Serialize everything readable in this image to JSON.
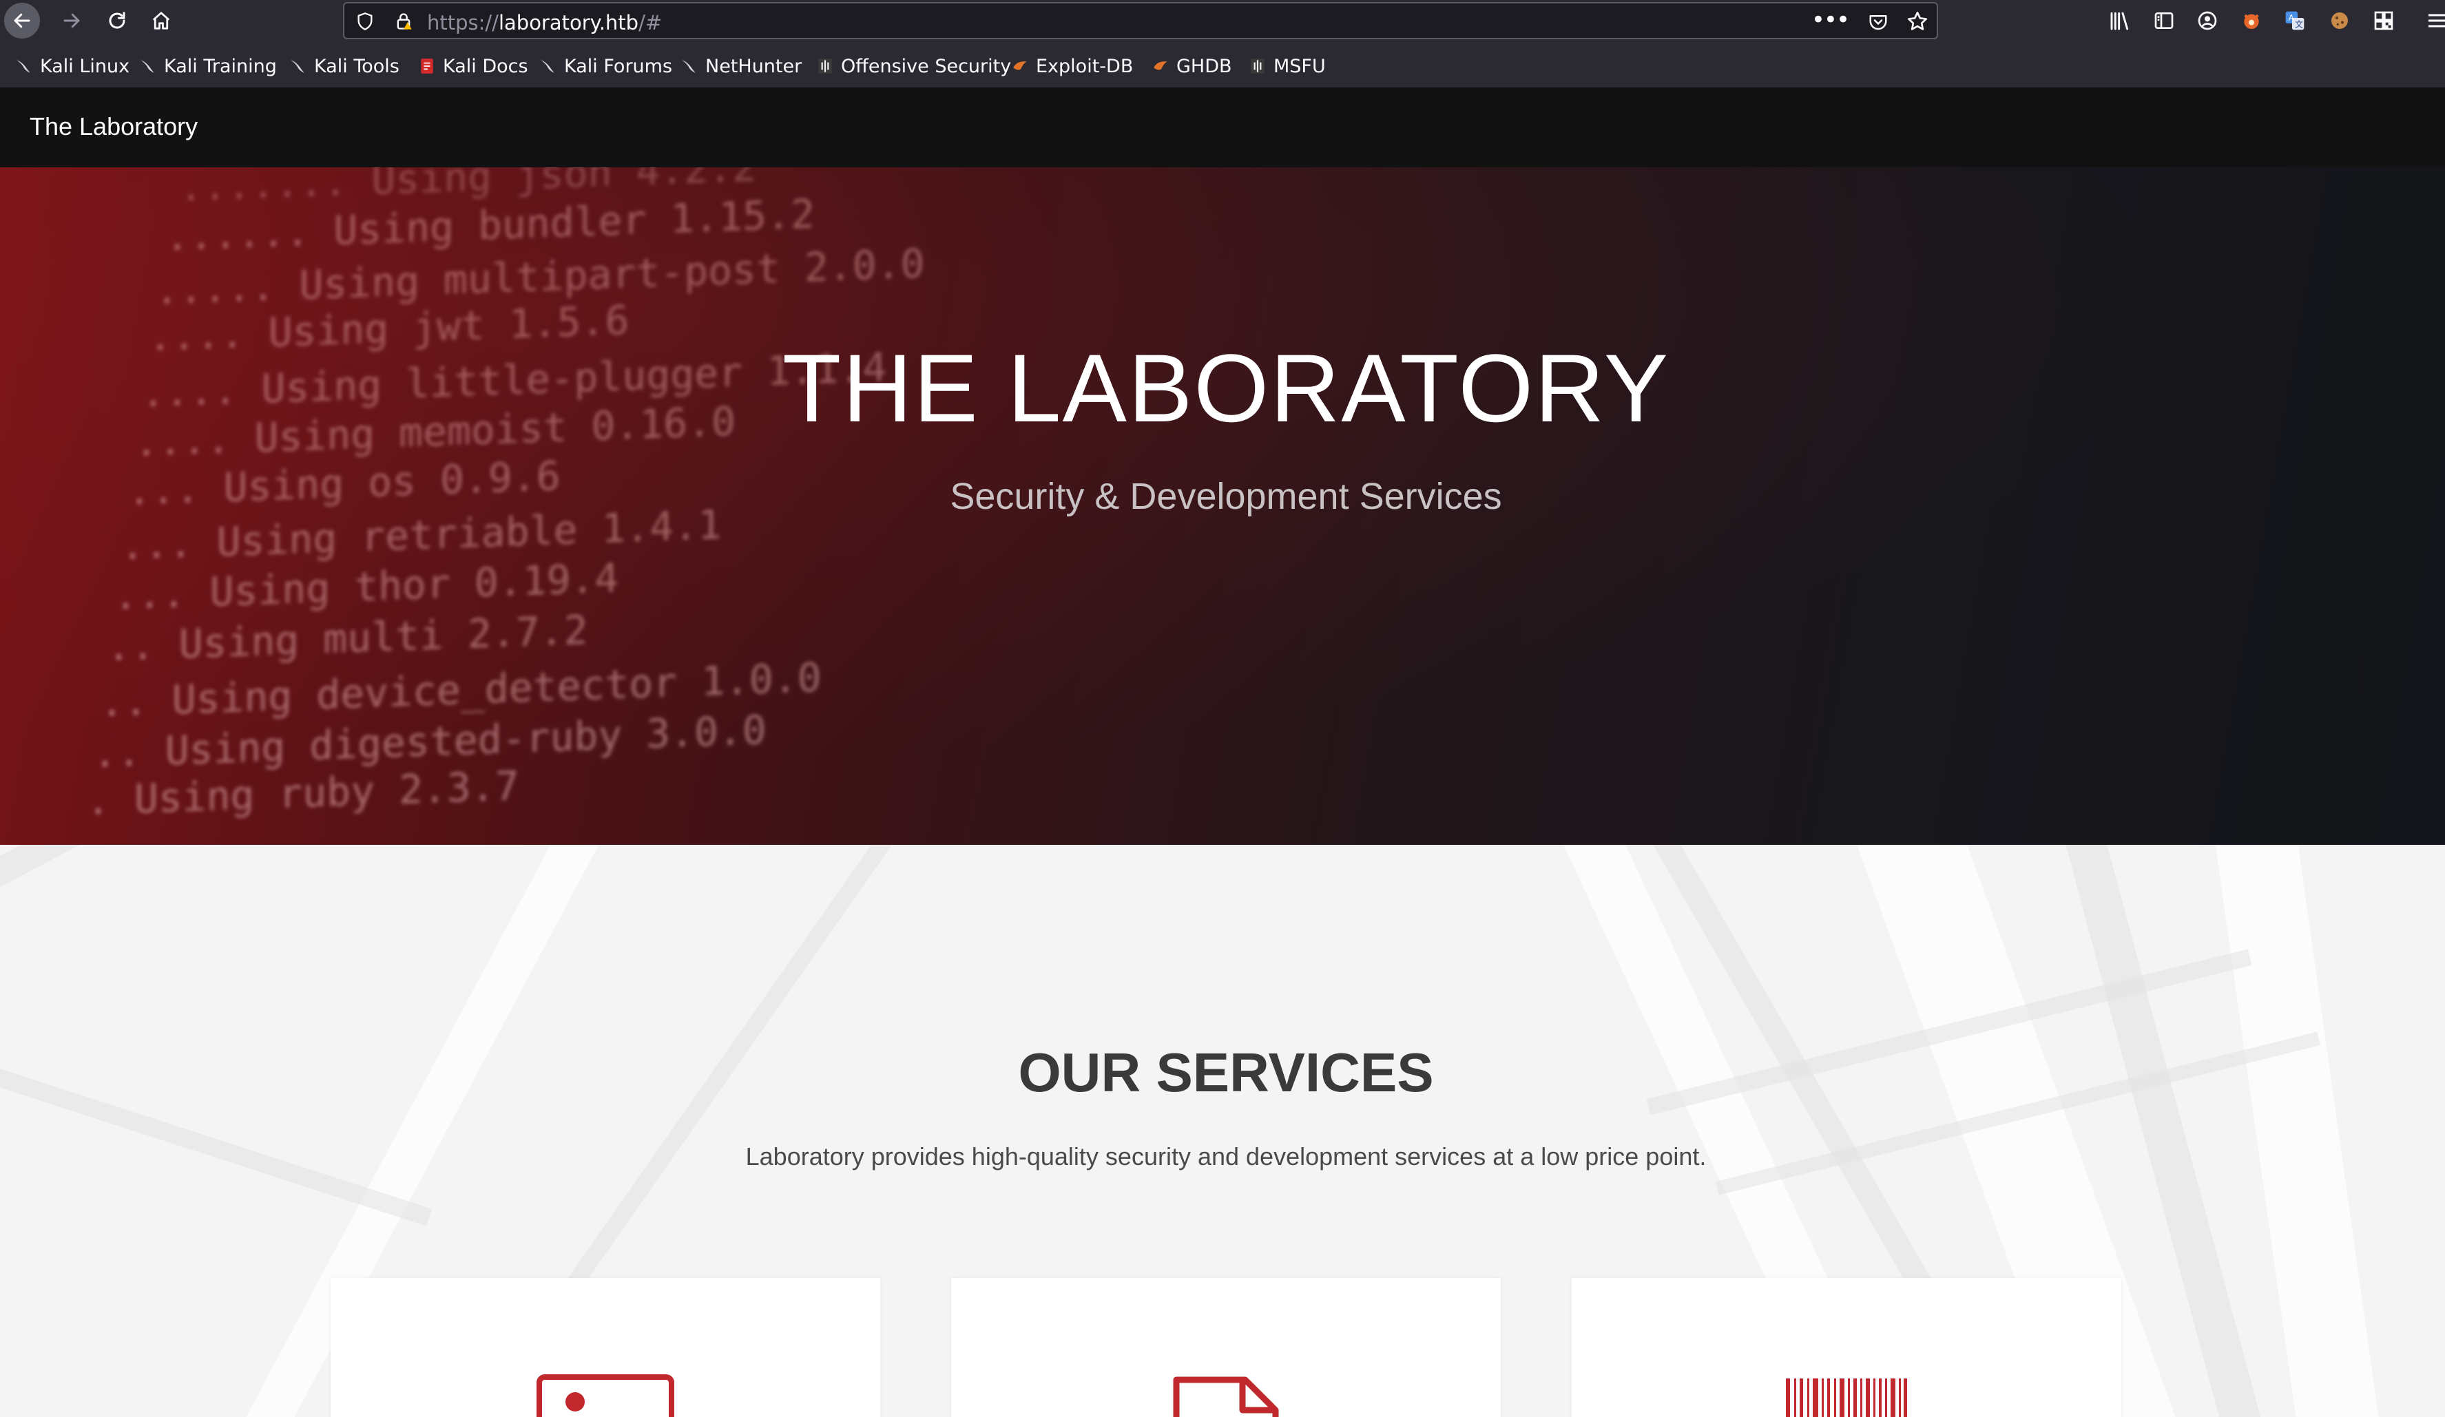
{
  "browser": {
    "url_scheme": "https://",
    "url_host": "laboratory.htb",
    "url_path": "/#",
    "bookmarks": [
      {
        "label": "Kali Linux",
        "icon": "kali-dragon-icon"
      },
      {
        "label": "Kali Training",
        "icon": "kali-dragon-icon"
      },
      {
        "label": "Kali Tools",
        "icon": "kali-dragon-icon"
      },
      {
        "label": "Kali Docs",
        "icon": "kali-docs-icon"
      },
      {
        "label": "Kali Forums",
        "icon": "kali-dragon-icon"
      },
      {
        "label": "NetHunter",
        "icon": "kali-dragon-icon"
      },
      {
        "label": "Offensive Security",
        "icon": "offsec-icon"
      },
      {
        "label": "Exploit-DB",
        "icon": "exploit-db-icon"
      },
      {
        "label": "GHDB",
        "icon": "exploit-db-icon"
      },
      {
        "label": "MSFU",
        "icon": "offsec-icon"
      }
    ]
  },
  "site": {
    "brand": "The Laboratory",
    "hero": {
      "title": "THE LABORATORY",
      "subtitle": "Security & Development Services"
    },
    "services": {
      "title": "OUR SERVICES",
      "description": "Laboratory provides high-quality security and development services at a low price point.",
      "cards": [
        {
          "icon": "id-card-icon"
        },
        {
          "icon": "document-icon"
        },
        {
          "icon": "barcode-icon"
        }
      ]
    }
  },
  "colors": {
    "accent": "#c0282d",
    "navbar": "#121212",
    "chrome": "#2b2a33"
  }
}
